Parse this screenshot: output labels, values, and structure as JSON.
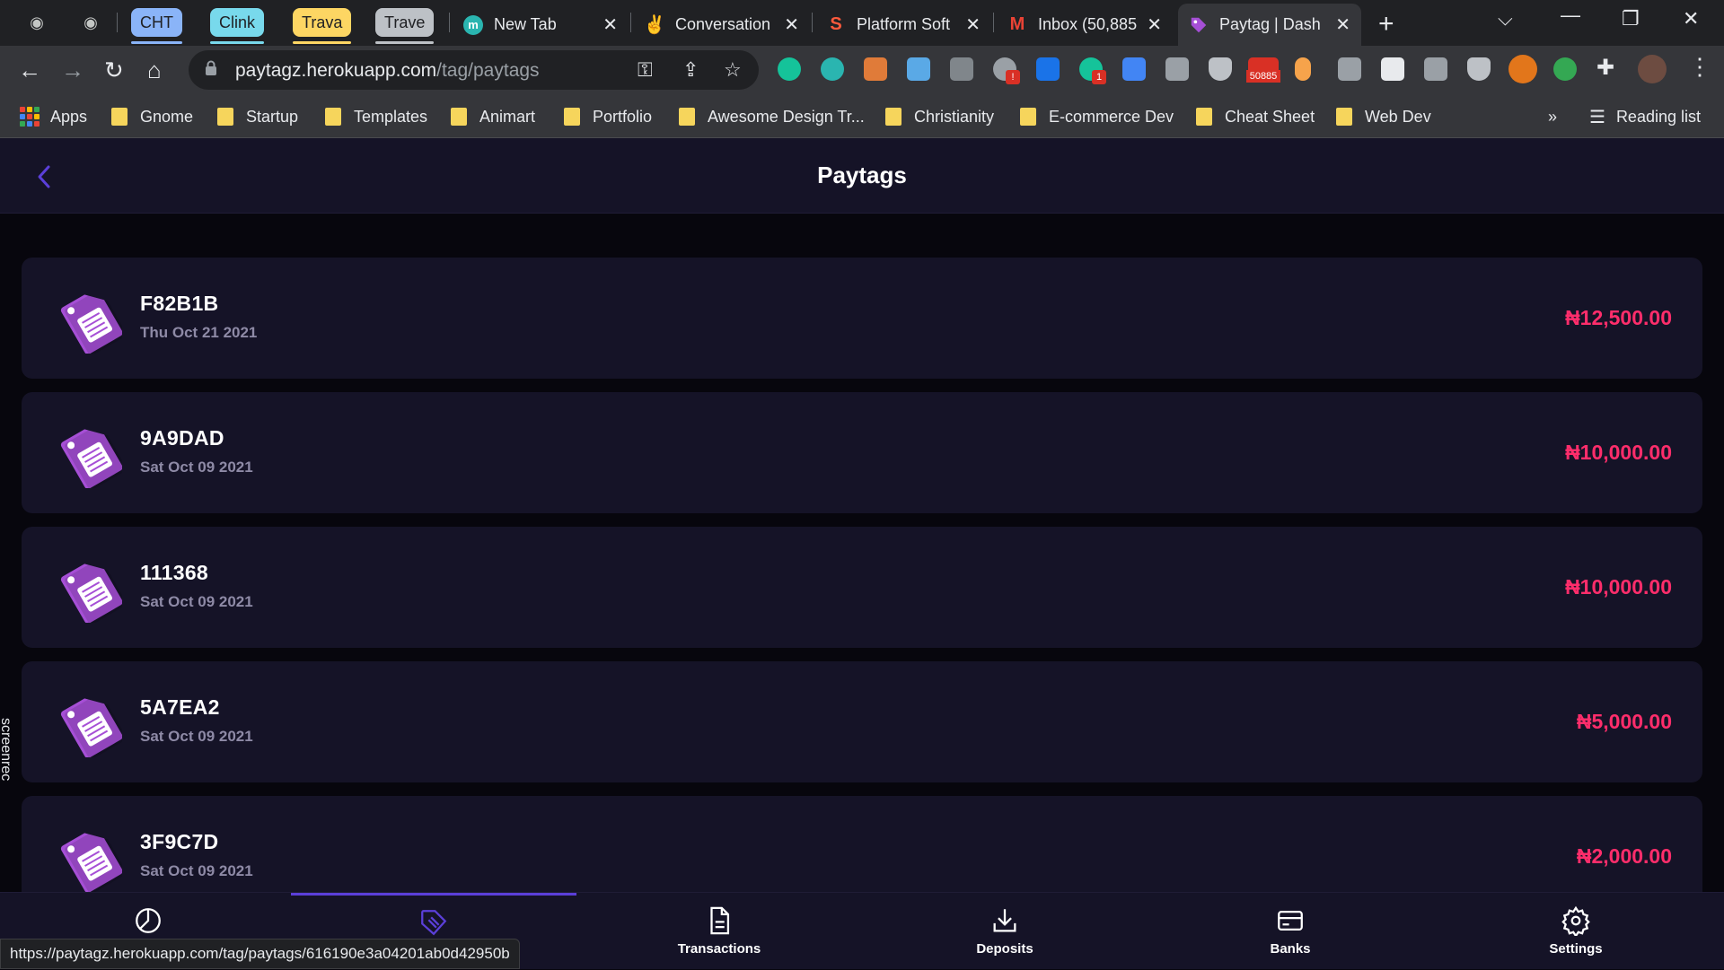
{
  "browser": {
    "tab_groups": [
      {
        "label": "CHT",
        "color": "#8ab4f8"
      },
      {
        "label": "Clink",
        "color": "#78d9ec"
      },
      {
        "label": "Trava",
        "color": "#fdd663"
      },
      {
        "label": "Trave",
        "color": "#bdc1c6"
      }
    ],
    "tabs": [
      {
        "title": "New Tab",
        "favicon": "m"
      },
      {
        "title": "Conversation",
        "favicon": "peace-icon"
      },
      {
        "title": "Platform Soft",
        "favicon": "s-logo-icon"
      },
      {
        "title": "Inbox (50,885",
        "favicon": "gmail-icon"
      },
      {
        "title": "Paytag | Dash",
        "favicon": "tag-icon"
      }
    ],
    "url_host": "paytagz.herokuapp.com",
    "url_path": "/tag/paytags",
    "mail_badge": "50885",
    "ext_badge_1": "!",
    "ext_badge_2": "1",
    "bookmarks": [
      "Apps",
      "Gnome",
      "Startup",
      "Templates",
      "Animart",
      "Portfolio",
      "Awesome Design Tr...",
      "Christianity",
      "E-commerce Dev",
      "Cheat Sheet",
      "Web Dev"
    ],
    "more_bookmarks": "»",
    "reading_list": "Reading list",
    "status_url": "https://paytagz.herokuapp.com/tag/paytags/616190e3a04201ab0d42950b",
    "screenrec_label": "screenrec"
  },
  "header": {
    "title": "Paytags"
  },
  "paytags": [
    {
      "code": "F82B1B",
      "date": "Thu Oct 21 2021",
      "amount": "₦12,500.00"
    },
    {
      "code": "9A9DAD",
      "date": "Sat Oct 09 2021",
      "amount": "₦10,000.00"
    },
    {
      "code": "111368",
      "date": "Sat Oct 09 2021",
      "amount": "₦10,000.00"
    },
    {
      "code": "5A7EA2",
      "date": "Sat Oct 09 2021",
      "amount": "₦5,000.00"
    },
    {
      "code": "3F9C7D",
      "date": "Sat Oct 09 2021",
      "amount": "₦2,000.00"
    }
  ],
  "bottom_nav": [
    {
      "label": "",
      "icon": "pie-chart-icon"
    },
    {
      "label": "",
      "icon": "tag-icon"
    },
    {
      "label": "Transactions",
      "icon": "document-icon"
    },
    {
      "label": "Deposits",
      "icon": "download-icon"
    },
    {
      "label": "Banks",
      "icon": "card-icon"
    },
    {
      "label": "Settings",
      "icon": "gear-icon"
    }
  ],
  "colors": {
    "accent": "#5b3fd9",
    "amount": "#ff2d6b",
    "card": "#151327",
    "tag": "#a64fd6"
  }
}
